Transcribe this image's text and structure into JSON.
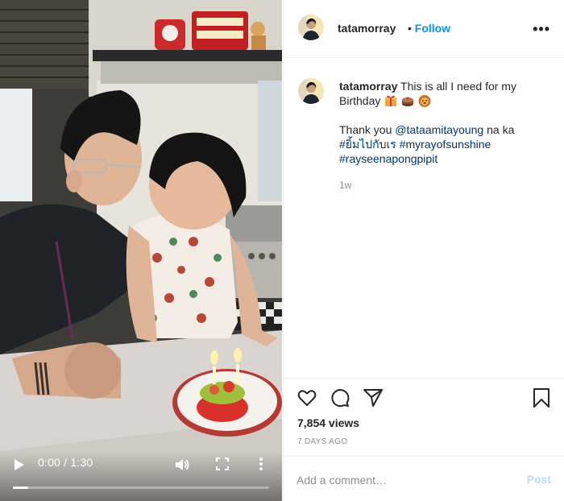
{
  "post": {
    "username": "tatamorray",
    "follow_label": "Follow",
    "separator": "•",
    "more_label": "•••"
  },
  "video": {
    "time_display": "0:00 / 1:30",
    "progress_fraction": 0.06,
    "icons": [
      "play-icon",
      "volume-icon",
      "fullscreen-icon",
      "more-vertical-icon"
    ]
  },
  "caption": {
    "username": "tatamorray",
    "line1": "This is all I need for my",
    "line2": "Birthday",
    "emojis": [
      "gift-emoji",
      "cake-emoji",
      "lion-emoji"
    ],
    "thanks_prefix": "Thank you",
    "mention": "@tataamitayoung",
    "thanks_suffix": "na ka",
    "hashtags": [
      "#ยิ้มไปกับเร",
      "#myrayofsunshine",
      "#rayseenapongpipit"
    ],
    "time_ago": "1w"
  },
  "stats": {
    "views": "7,854 views",
    "date": "7 DAYS AGO"
  },
  "comment": {
    "placeholder": "Add a comment…",
    "post_label": "Post"
  },
  "colors": {
    "link_blue": "#0095f6",
    "hashtag_blue": "#00376b",
    "post_disabled": "#b2dffc",
    "muted": "#8e8e8e"
  }
}
